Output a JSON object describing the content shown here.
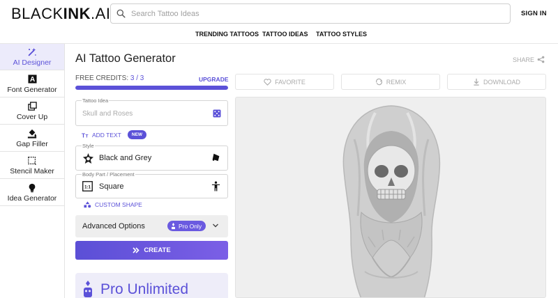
{
  "header": {
    "logo": {
      "black": "BLACK",
      "ink": "INK",
      "ai": ".AI"
    },
    "search": {
      "placeholder": "Search Tattoo Ideas"
    },
    "signin": "SIGN IN",
    "nav": [
      "TRENDING TATTOOS",
      "TATTOO IDEAS",
      "TATTOO STYLES"
    ]
  },
  "sidebar": {
    "items": [
      {
        "label": "AI Designer",
        "icon": "magic-wand-icon",
        "active": true
      },
      {
        "label": "Font Generator",
        "icon": "letter-a-icon",
        "active": false
      },
      {
        "label": "Cover Up",
        "icon": "cover-up-icon",
        "active": false
      },
      {
        "label": "Gap Filler",
        "icon": "paint-bucket-icon",
        "active": false
      },
      {
        "label": "Stencil Maker",
        "icon": "stencil-icon",
        "active": false
      },
      {
        "label": "Idea Generator",
        "icon": "lightbulb-icon",
        "active": false
      }
    ]
  },
  "main": {
    "title": "AI Tattoo Generator",
    "share": "SHARE",
    "credits": {
      "label": "FREE CREDITS:",
      "value": "3 / 3",
      "fraction": 1.0,
      "upgrade": "UPGRADE"
    },
    "tattoo_idea": {
      "label": "Tattoo Idea",
      "placeholder": "Skull and Roses",
      "icon": "dice-icon"
    },
    "add_text": {
      "label": "ADD TEXT",
      "badge": "NEW"
    },
    "style": {
      "label": "Style",
      "value": "Black and Grey",
      "icon": "ink-icon"
    },
    "placement": {
      "label": "Body Part / Placement",
      "value": "Square",
      "ratio_icon": "1:1",
      "icon": "body-icon"
    },
    "custom_shape": "CUSTOM SHAPE",
    "advanced": {
      "label": "Advanced Options",
      "pro": "Pro Only"
    },
    "create": "CREATE",
    "pro_unlimited": "Pro Unlimited"
  },
  "actions": {
    "favorite": "FAVORITE",
    "remix": "REMIX",
    "download": "DOWNLOAD"
  },
  "colors": {
    "accent": "#5b51d8",
    "progress_bg": "#e0defa",
    "canvas_bg": "#efefef"
  }
}
